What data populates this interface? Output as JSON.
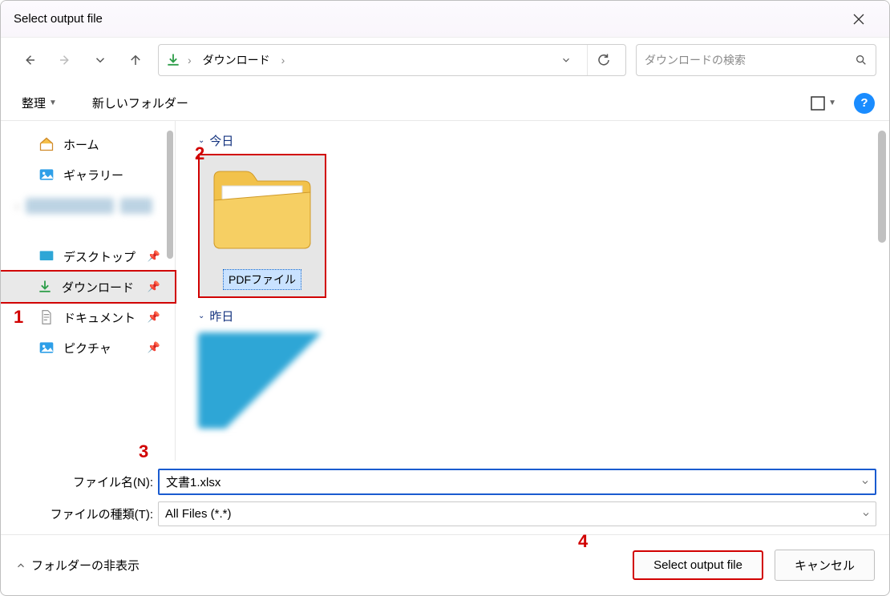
{
  "title": "Select output file",
  "breadcrumb": {
    "root_icon": "download",
    "segment1": "ダウンロード"
  },
  "search": {
    "placeholder": "ダウンロードの検索"
  },
  "toolbar": {
    "organize": "整理",
    "new_folder": "新しいフォルダー"
  },
  "sidebar": {
    "home": "ホーム",
    "gallery": "ギャラリー",
    "desktop": "デスクトップ",
    "downloads": "ダウンロード",
    "documents": "ドキュメント",
    "pictures": "ピクチャ"
  },
  "groups": {
    "g1": "今日",
    "g2": "昨日"
  },
  "folder1": {
    "name": "PDFファイル"
  },
  "fields": {
    "filename_label": "ファイル名(N):",
    "filetype_label": "ファイルの種類(T):",
    "filename_value": "文書1.xlsx",
    "filetype_value": "All Files (*.*)"
  },
  "bottom": {
    "hide_folders": "フォルダーの非表示",
    "select": "Select output file",
    "cancel": "キャンセル"
  },
  "annotations": {
    "a1": "1",
    "a2": "2",
    "a3": "3",
    "a4": "4"
  }
}
